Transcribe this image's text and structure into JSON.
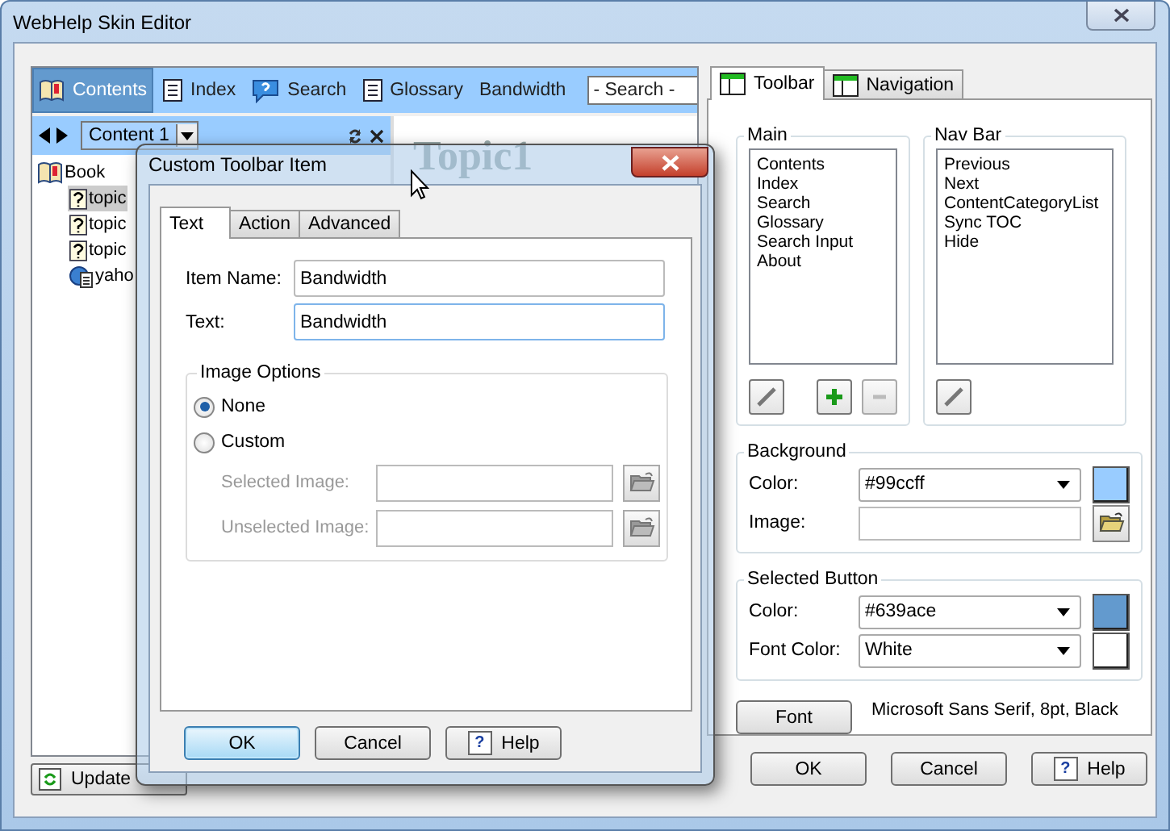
{
  "window": {
    "title": "WebHelp Skin Editor"
  },
  "preview": {
    "toolbar_items": [
      {
        "label": "Contents",
        "kind": "book",
        "selected": true
      },
      {
        "label": "Index",
        "kind": "page",
        "selected": false
      },
      {
        "label": "Search",
        "kind": "bubble",
        "selected": false
      },
      {
        "label": "Glossary",
        "kind": "page",
        "selected": false
      },
      {
        "label": "Bandwidth",
        "kind": "text",
        "selected": false
      }
    ],
    "search": {
      "placeholder": "- Search -"
    },
    "nav_dropdown": "Content 1",
    "tree": [
      {
        "label": "Book",
        "kind": "book",
        "selected": false,
        "children": [
          {
            "label": "topic",
            "kind": "topic",
            "selected": true
          },
          {
            "label": "topic",
            "kind": "topic",
            "selected": false
          },
          {
            "label": "topic",
            "kind": "topic",
            "selected": false
          },
          {
            "label": "yaho",
            "kind": "link",
            "selected": false
          }
        ]
      }
    ],
    "topic_heading": "Topic1",
    "update_button": "Update"
  },
  "right_panel": {
    "tabs": [
      {
        "label": "Toolbar",
        "selected": true
      },
      {
        "label": "Navigation",
        "selected": false
      }
    ],
    "lists": [
      {
        "title": "Main",
        "items": [
          "Contents",
          "Index",
          "Search",
          "Glossary",
          "Search Input",
          "About"
        ],
        "tools": [
          {
            "kind": "edit",
            "disabled": false
          },
          {
            "kind": "add",
            "disabled": false
          },
          {
            "kind": "remove",
            "disabled": true
          }
        ]
      },
      {
        "title": "Nav Bar",
        "items": [
          "Previous",
          "Next",
          "ContentCategoryList",
          "Sync TOC",
          "Hide"
        ],
        "tools": [
          {
            "kind": "edit",
            "disabled": false
          }
        ]
      }
    ],
    "groups": [
      {
        "title": "Background",
        "fields": [
          {
            "label": "Color:",
            "kind": "color",
            "value": "#99ccff",
            "color": "#99ccff"
          },
          {
            "label": "Image:",
            "kind": "image"
          }
        ]
      },
      {
        "title": "Selected Button",
        "fields": [
          {
            "label": "Color:",
            "kind": "color",
            "value": "#639ace",
            "color": "#639ace"
          },
          {
            "label": "Font Color:",
            "kind": "color",
            "value": "White",
            "color": "#ffffff"
          }
        ]
      }
    ],
    "font": {
      "button": "Font",
      "description": "Microsoft Sans Serif, 8pt, Black"
    },
    "buttons": [
      {
        "label": "OK",
        "kind": "normal"
      },
      {
        "label": "Cancel",
        "kind": "normal"
      },
      {
        "label": "Help",
        "kind": "help",
        "icon": "?"
      }
    ]
  },
  "dialog": {
    "title": "Custom Toolbar Item",
    "tabs": [
      {
        "label": "Text",
        "selected": true
      },
      {
        "label": "Action",
        "selected": false
      },
      {
        "label": "Advanced",
        "selected": false
      }
    ],
    "fields": [
      {
        "label": "Item Name:",
        "value": "Bandwidth",
        "focused": false
      },
      {
        "label": "Text:",
        "value": "Bandwidth",
        "focused": true
      }
    ],
    "image_options": {
      "title": "Image Options",
      "options": [
        {
          "label": "None",
          "selected": true
        },
        {
          "label": "Custom",
          "selected": false
        }
      ],
      "image_fields": [
        {
          "label": "Selected Image:",
          "disabled": true
        },
        {
          "label": "Unselected Image:",
          "disabled": true
        }
      ]
    },
    "buttons": [
      {
        "label": "OK",
        "kind": "default"
      },
      {
        "label": "Cancel",
        "kind": "normal"
      },
      {
        "label": "Help",
        "kind": "help",
        "icon": "?"
      }
    ]
  }
}
